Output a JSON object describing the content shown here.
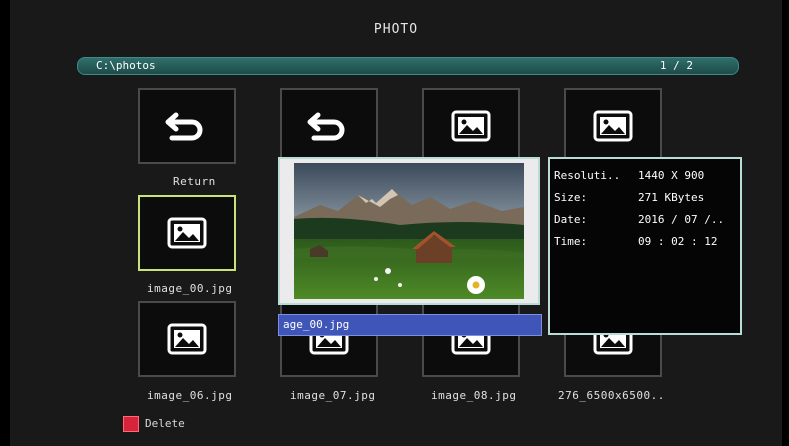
{
  "title": "PHOTO",
  "path": {
    "current": "C:\\photos",
    "page": "1 / 2"
  },
  "items": [
    {
      "label": "Return",
      "icon": "return-icon"
    },
    {
      "label": "",
      "icon": "return-icon"
    },
    {
      "label": "",
      "icon": "image-icon"
    },
    {
      "label": "",
      "icon": "image-icon"
    },
    {
      "label": "image_00.jpg",
      "icon": "image-icon",
      "selected": true
    },
    {
      "label": "image_06.jpg",
      "icon": "image-icon"
    },
    {
      "label": "image_07.jpg",
      "icon": "image-icon"
    },
    {
      "label": "image_08.jpg",
      "icon": "image-icon"
    },
    {
      "label": "276_6500x6500..",
      "icon": "image-icon"
    }
  ],
  "preview": {
    "filename": "age_00.jpg"
  },
  "info": {
    "resolution_label": "Resoluti..",
    "resolution": "1440 X 900",
    "size_label": "Size:",
    "size": "271 KBytes",
    "date_label": "Date:",
    "date": "2016 / 07 /..",
    "time_label": "Time:",
    "time": "09 : 02 : 12"
  },
  "footer": {
    "delete_label": "Delete",
    "delete_color": "#d8243a"
  },
  "colors": {
    "path_bar": "#2f6f6c",
    "selection": "#c9e27a",
    "highlight": "#3f55b8",
    "panel_border": "#b9dcd7"
  }
}
